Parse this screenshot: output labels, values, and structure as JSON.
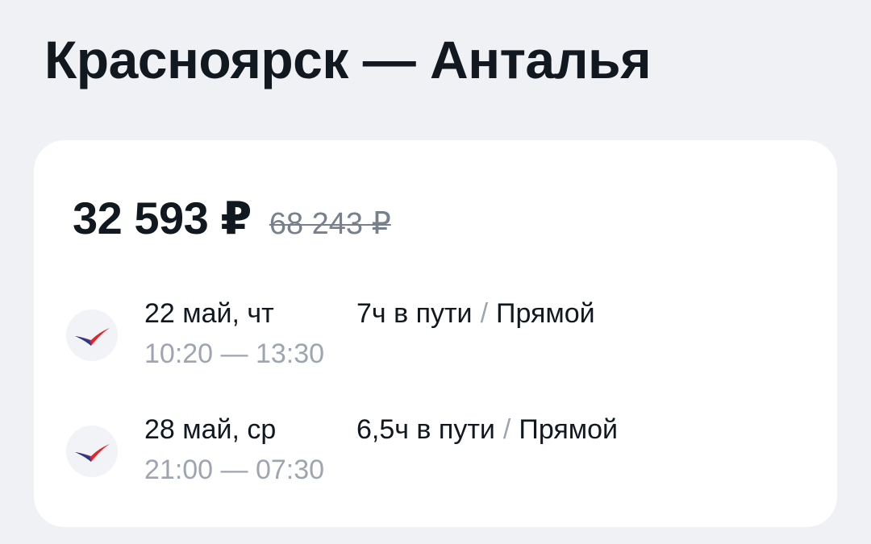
{
  "route": {
    "title": "Красноярск — Анталья"
  },
  "offer": {
    "price": "32 593 ₽",
    "old_price": "68 243 ₽",
    "segments": [
      {
        "date": "22 май, чт",
        "times": "10:20 — 13:30",
        "duration": "7ч в пути",
        "separator": "/",
        "type": "Прямой",
        "airline_icon": "airline-logo-icon"
      },
      {
        "date": "28 май, ср",
        "times": "21:00 — 07:30",
        "duration": "6,5ч в пути",
        "separator": "/",
        "type": "Прямой",
        "airline_icon": "airline-logo-icon"
      }
    ]
  },
  "colors": {
    "background": "#eff1f5",
    "card": "#ffffff",
    "text_primary": "#111820",
    "text_secondary": "#9ea5b0",
    "logo_red": "#e5232b",
    "logo_blue": "#1d3f8f"
  }
}
